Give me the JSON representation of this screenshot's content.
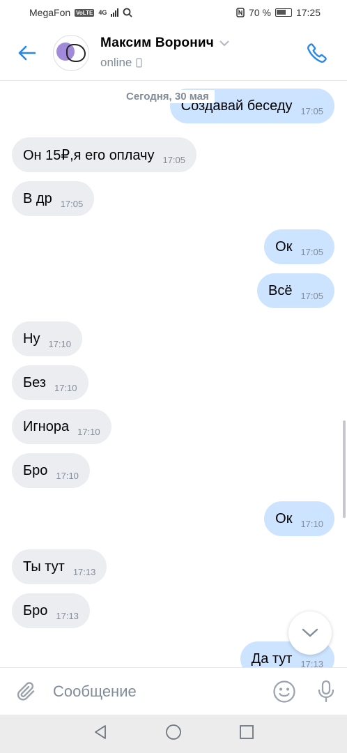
{
  "status_bar": {
    "carrier": "MegaFon",
    "volte": "VoLTE",
    "network": "4G",
    "battery": "70 %",
    "time": "17:25"
  },
  "header": {
    "name": "Максим Воронич",
    "status": "online"
  },
  "date_separator": "Сегодня, 30 мая",
  "messages": [
    {
      "dir": "out",
      "text": "Создавай беседу",
      "time": "17:05"
    },
    {
      "dir": "in",
      "text": "Он 15₽,я его оплачу",
      "time": "17:05"
    },
    {
      "dir": "in",
      "text": "В др",
      "time": "17:05"
    },
    {
      "dir": "out",
      "text": "Ок",
      "time": "17:05"
    },
    {
      "dir": "out",
      "text": "Всё",
      "time": "17:05"
    },
    {
      "dir": "in",
      "text": "Ну",
      "time": "17:10"
    },
    {
      "dir": "in",
      "text": "Без",
      "time": "17:10"
    },
    {
      "dir": "in",
      "text": "Игнора",
      "time": "17:10"
    },
    {
      "dir": "in",
      "text": "Бро",
      "time": "17:10"
    },
    {
      "dir": "out",
      "text": "Ок",
      "time": "17:10"
    },
    {
      "dir": "in",
      "text": "Ты тут",
      "time": "17:13"
    },
    {
      "dir": "in",
      "text": "Бро",
      "time": "17:13"
    },
    {
      "dir": "out",
      "text": "Да тут",
      "time": "17:13"
    }
  ],
  "composer": {
    "placeholder": "Сообщение"
  },
  "icons": {
    "back": "arrow-left-icon",
    "call": "phone-icon",
    "attach": "paperclip-icon",
    "emoji": "smile-icon",
    "voice": "microphone-icon",
    "scroll_down": "chevron-down-icon",
    "nav_back": "triangle-back-icon",
    "nav_home": "circle-home-icon",
    "nav_recent": "square-recent-icon"
  },
  "colors": {
    "accent": "#2688eb",
    "bubble_in": "#ebedf0",
    "bubble_out": "#cce4ff",
    "secondary_text": "#818c99"
  }
}
